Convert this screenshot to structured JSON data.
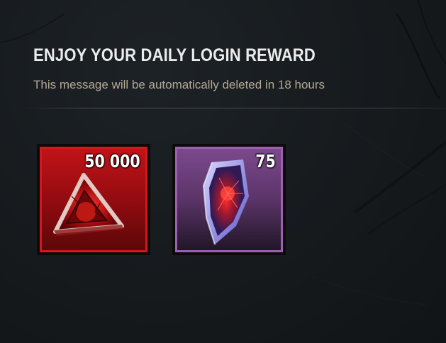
{
  "header": {
    "title": "ENJOY YOUR DAILY LOGIN REWARD",
    "subtitle": "This message will be automatically deleted in 18 hours"
  },
  "rewards": [
    {
      "amount": "50 000",
      "icon": "bloodpoints-icon",
      "frame_color": "#c31318"
    },
    {
      "amount": "75",
      "icon": "iridescent-shards-icon",
      "frame_color": "#7d4a8e"
    }
  ],
  "colors": {
    "background": "#161a1d",
    "title": "#ececec",
    "subtitle": "#b3a994"
  }
}
